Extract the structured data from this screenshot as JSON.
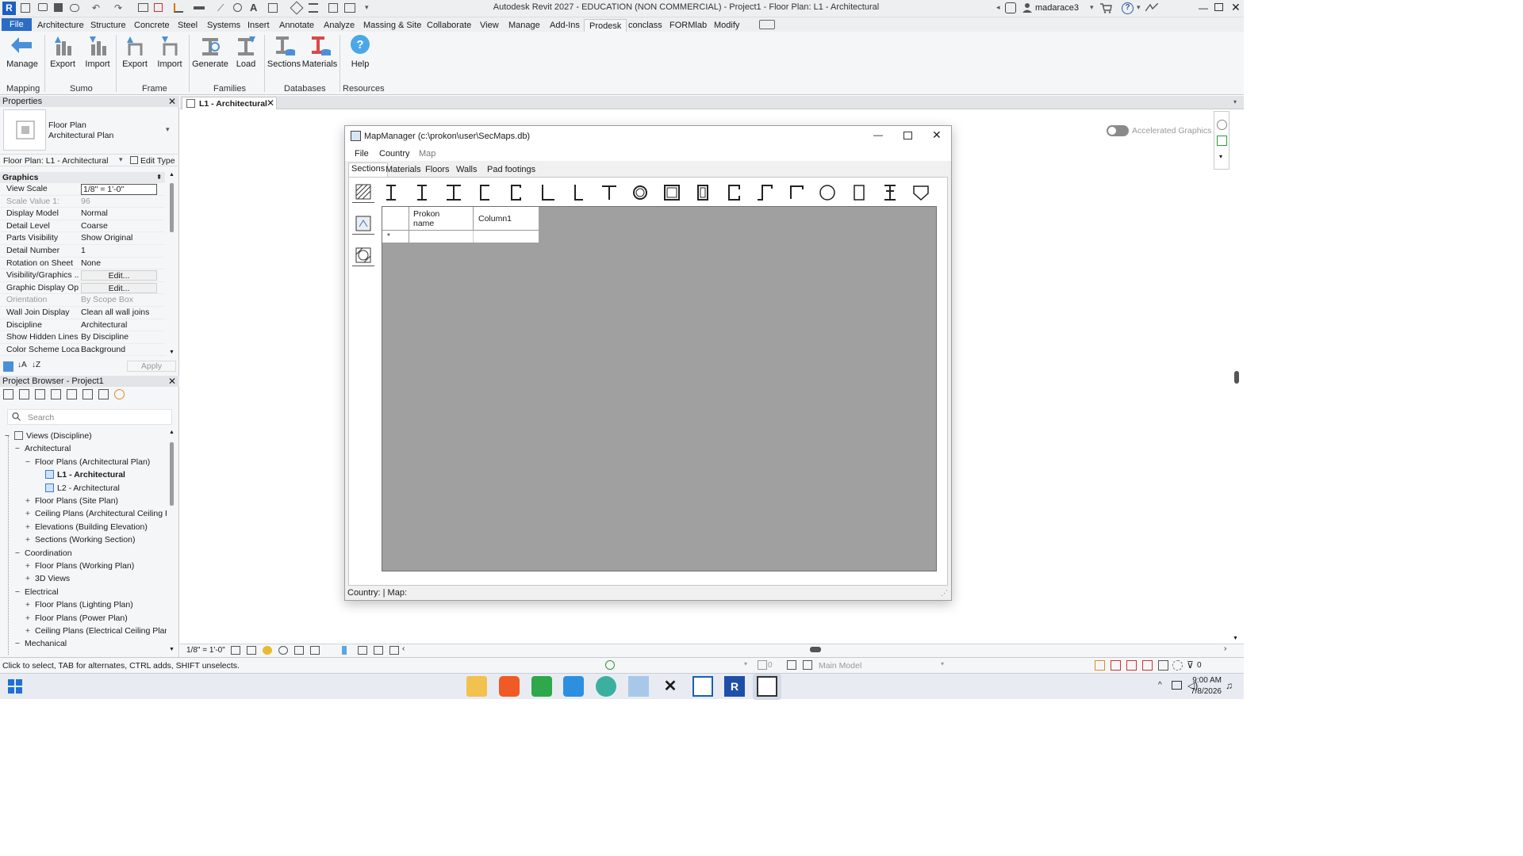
{
  "app": {
    "title": "Autodesk Revit 2027 - EDUCATION (NON COMMERCIAL) - Project1 - Floor Plan: L1 - Architectural",
    "user": "madarace3"
  },
  "ribbon_tabs": [
    "File",
    "Architecture",
    "Structure",
    "Concrete",
    "Steel",
    "Systems",
    "Insert",
    "Annotate",
    "Analyze",
    "Massing & Site",
    "Collaborate",
    "View",
    "Manage",
    "Add-Ins",
    "Prodesk",
    "conclass",
    "FORMlab",
    "Modify"
  ],
  "active_tab": "Prodesk",
  "ribbon": {
    "buttons": [
      {
        "label": "Manage",
        "icon": "manage-icon"
      },
      {
        "label": "Export",
        "icon": "export-icon"
      },
      {
        "label": "Import",
        "icon": "import-icon"
      },
      {
        "label": "Export",
        "icon": "export-frame-icon"
      },
      {
        "label": "Import",
        "icon": "import-frame-icon"
      },
      {
        "label": "Generate",
        "icon": "generate-icon"
      },
      {
        "label": "Load",
        "icon": "load-icon"
      },
      {
        "label": "Sections",
        "icon": "sections-db-icon"
      },
      {
        "label": "Materials",
        "icon": "materials-db-icon"
      },
      {
        "label": "Help",
        "icon": "help-icon"
      }
    ],
    "panels": [
      "Mapping",
      "Sumo",
      "Frame",
      "Families",
      "Databases",
      "Resources"
    ]
  },
  "properties": {
    "header": "Properties",
    "type_name": "Floor Plan",
    "type_sub": "Architectural Plan",
    "selector": "Floor Plan: L1 - Architectural",
    "edit_type": "Edit Type",
    "group": "Graphics",
    "rows": [
      {
        "k": "View Scale",
        "v": "1/8\" = 1'-0\""
      },
      {
        "k": "Scale Value    1:",
        "v": "96"
      },
      {
        "k": "Display Model",
        "v": "Normal"
      },
      {
        "k": "Detail Level",
        "v": "Coarse"
      },
      {
        "k": "Parts Visibility",
        "v": "Show Original"
      },
      {
        "k": "Detail Number",
        "v": "1"
      },
      {
        "k": "Rotation on Sheet",
        "v": "None"
      },
      {
        "k": "Visibility/Graphics ...",
        "v": "Edit..."
      },
      {
        "k": "Graphic Display Op...",
        "v": "Edit..."
      },
      {
        "k": "Orientation",
        "v": "By Scope Box"
      },
      {
        "k": "Wall Join Display",
        "v": "Clean all wall joins"
      },
      {
        "k": "Discipline",
        "v": "Architectural"
      },
      {
        "k": "Show Hidden Lines",
        "v": "By Discipline"
      },
      {
        "k": "Color Scheme Loca...",
        "v": "Background"
      }
    ],
    "apply": "Apply"
  },
  "browser": {
    "header": "Project Browser - Project1",
    "search_placeholder": "Search",
    "items": [
      {
        "label": "Views (Discipline)",
        "level": 0,
        "pm": "−",
        "bold": false
      },
      {
        "label": "Architectural",
        "level": 1,
        "pm": "−",
        "bold": false
      },
      {
        "label": "Floor Plans (Architectural Plan)",
        "level": 2,
        "pm": "−",
        "bold": false
      },
      {
        "label": "L1 - Architectural",
        "level": 3,
        "pm": "",
        "bold": true
      },
      {
        "label": "L2 - Architectural",
        "level": 3,
        "pm": "",
        "bold": false
      },
      {
        "label": "Floor Plans (Site Plan)",
        "level": 2,
        "pm": "+",
        "bold": false
      },
      {
        "label": "Ceiling Plans (Architectural Ceiling Pla",
        "level": 2,
        "pm": "+",
        "bold": false
      },
      {
        "label": "Elevations (Building Elevation)",
        "level": 2,
        "pm": "+",
        "bold": false
      },
      {
        "label": "Sections (Working Section)",
        "level": 2,
        "pm": "+",
        "bold": false
      },
      {
        "label": "Coordination",
        "level": 1,
        "pm": "−",
        "bold": false
      },
      {
        "label": "Floor Plans (Working Plan)",
        "level": 2,
        "pm": "+",
        "bold": false
      },
      {
        "label": "3D Views",
        "level": 2,
        "pm": "+",
        "bold": false
      },
      {
        "label": "Electrical",
        "level": 1,
        "pm": "−",
        "bold": false
      },
      {
        "label": "Floor Plans (Lighting Plan)",
        "level": 2,
        "pm": "+",
        "bold": false
      },
      {
        "label": "Floor Plans (Power Plan)",
        "level": 2,
        "pm": "+",
        "bold": false
      },
      {
        "label": "Ceiling Plans (Electrical Ceiling Plan)",
        "level": 2,
        "pm": "+",
        "bold": false
      },
      {
        "label": "Mechanical",
        "level": 1,
        "pm": "−",
        "bold": false
      }
    ]
  },
  "view": {
    "tab_label": "L1 - Architectural",
    "accelerated_graphics": "Accelerated Graphics",
    "scale": "1/8\" = 1'-0\""
  },
  "status": {
    "hint": "Click to select, TAB for alternates, CTRL adds, SHIFT unselects.",
    "zero1": "0",
    "model": "Main Model",
    "filter_count": "0"
  },
  "dialog": {
    "title": "MapManager (c:\\prokon\\user\\SecMaps.db)",
    "menu": [
      "File",
      "Country",
      "Map"
    ],
    "tabs": [
      "Sections",
      "Materials",
      "Floors",
      "Walls",
      "Pad footings"
    ],
    "active_tab": "Sections",
    "section_shapes": [
      "i-section-icon",
      "i-section-icon",
      "wide-flange-icon",
      "channel-icon",
      "lipped-channel-icon",
      "angle-icon",
      "unequal-angle-icon",
      "tee-icon",
      "circular-hollow-icon",
      "square-hollow-icon",
      "rect-hollow-icon",
      "channel-lip-icon",
      "z-section-icon",
      "lipped-angle-icon",
      "circle-solid-icon",
      "rectangle-solid-icon",
      "tapered-i-icon",
      "pentagon-icon"
    ],
    "grid": {
      "headers": [
        "Prokon\nname",
        "Column1"
      ],
      "new_row_marker": "*"
    },
    "status": "Country:  |  Map:"
  },
  "clock": {
    "time": "9:00 AM",
    "date": "7/8/2026"
  }
}
